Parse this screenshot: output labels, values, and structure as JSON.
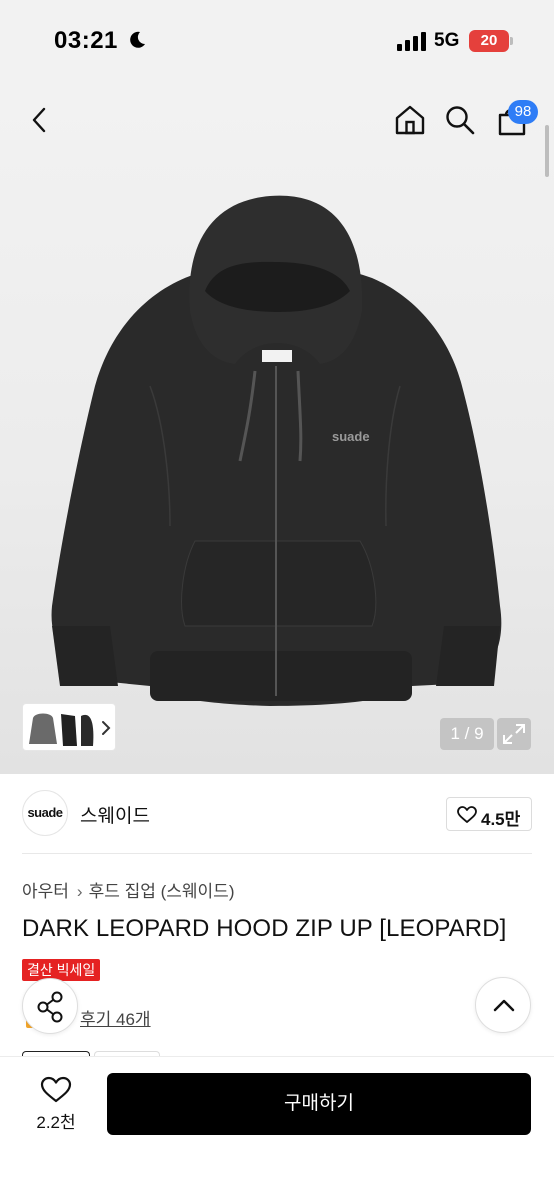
{
  "status_bar": {
    "time": "03:21",
    "network": "5G",
    "battery": "20"
  },
  "header": {
    "cart_count": "98"
  },
  "gallery": {
    "counter": "1 / 9",
    "logo_text": "suade"
  },
  "brand": {
    "logo_text": "suade",
    "name": "스웨이드",
    "likes": "4.5만"
  },
  "product": {
    "breadcrumb": [
      "아우터",
      "후드 집업 (스웨이드)"
    ],
    "title": "DARK LEOPARD HOOD ZIP UP [LEOPARD]",
    "sale_badge": "결산 빅세일",
    "review_link": "후기 46개"
  },
  "bottom_bar": {
    "wish_count": "2.2천",
    "buy_label": "구매하기"
  },
  "colors": {
    "accent_blue": "#2f7df6",
    "sale_red": "#e52222",
    "battery_red": "#e5403c",
    "button_black": "#000000"
  }
}
